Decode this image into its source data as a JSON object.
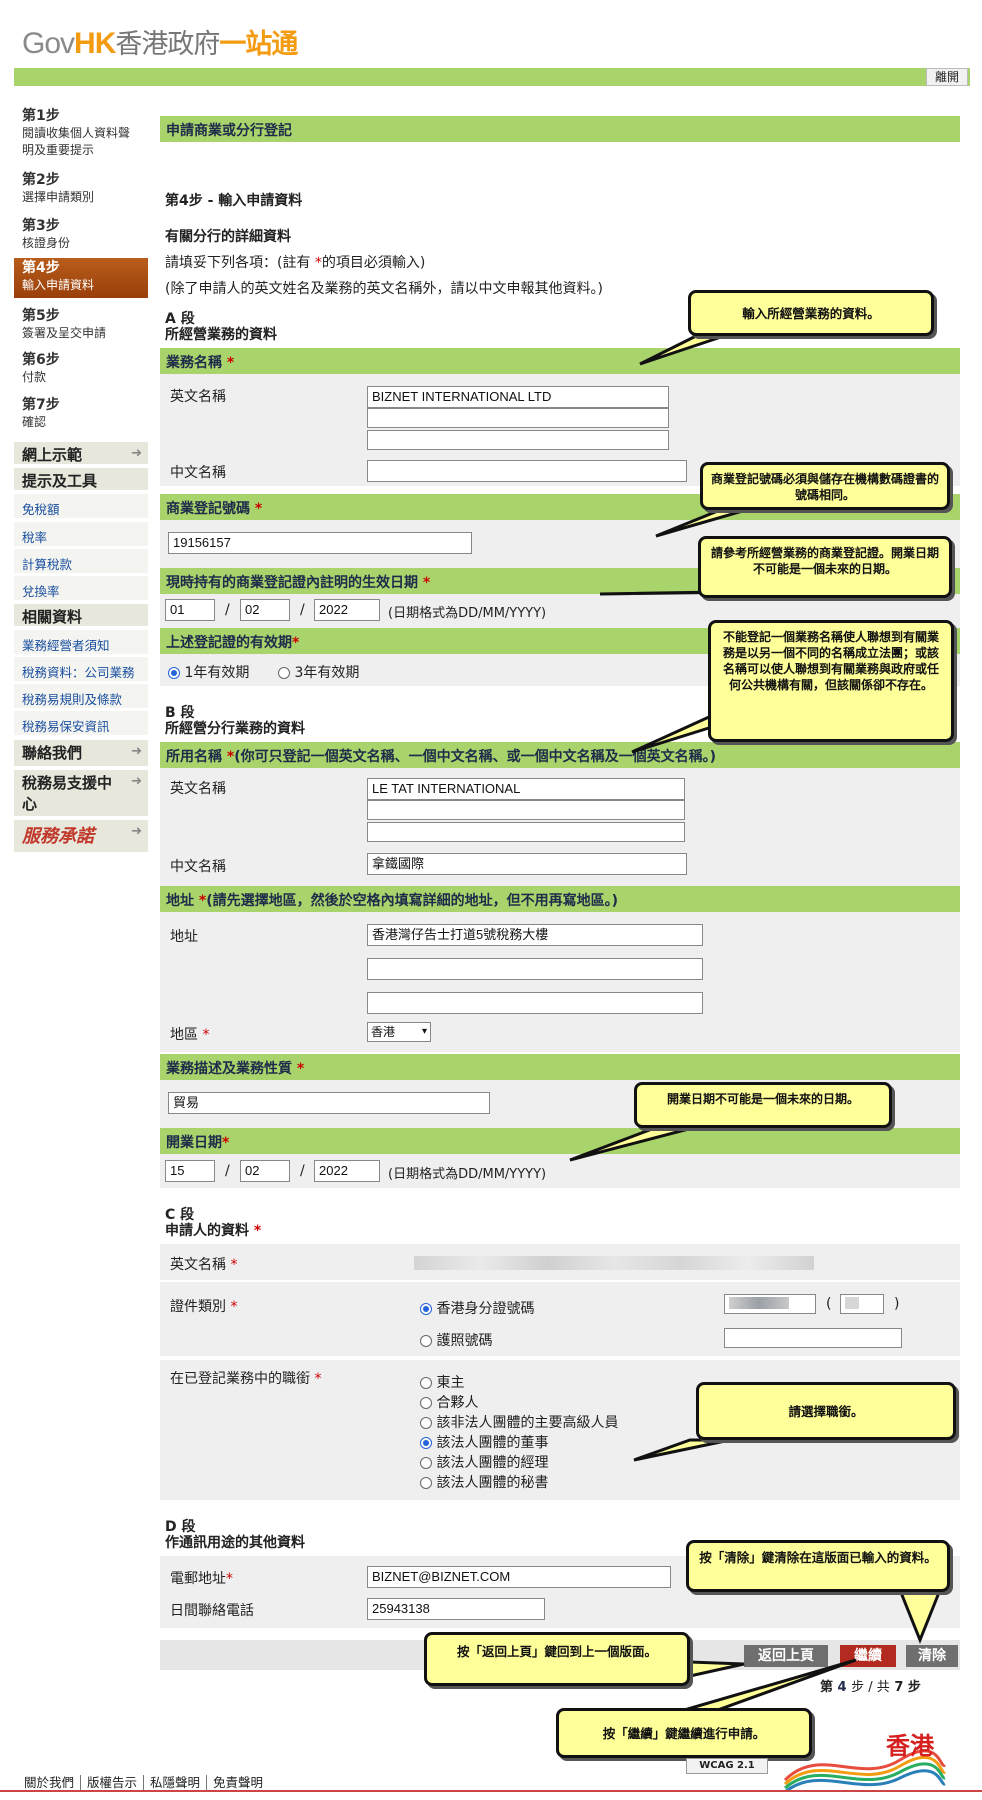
{
  "header": {
    "logo_gov": "Gov",
    "logo_hk": "HK",
    "logo_hkgov": "香港政府",
    "logo_onestop": "一站通",
    "logout_label": "離開"
  },
  "steps": [
    {
      "num": "第1步",
      "desc": "閱讀收集個人資料聲明及重要提示"
    },
    {
      "num": "第2步",
      "desc": "選擇申請類別"
    },
    {
      "num": "第3步",
      "desc": "核證身份"
    },
    {
      "num": "第4步",
      "desc": "輸入申請資料"
    },
    {
      "num": "第5步",
      "desc": "簽署及呈交申請"
    },
    {
      "num": "第6步",
      "desc": "付款"
    },
    {
      "num": "第7步",
      "desc": "確認"
    }
  ],
  "nav": {
    "demo": "網上示範",
    "tips": "提示及工具",
    "tips_links": [
      "免稅額",
      "稅率",
      "計算稅款",
      "兌換率"
    ],
    "related": "相關資料",
    "related_links": [
      "業務經營者須知",
      "稅務資料：公司業務",
      "稅務易規則及條款",
      "稅務易保安資訊"
    ],
    "contact": "聯絡我們",
    "support": "稅務易支援中心",
    "pledge": "服務承諾"
  },
  "page": {
    "title": "申請商業或分行登記",
    "step_title": "第4步  -  輸入申請資料",
    "subtitle": "有關分行的詳細資料",
    "note1_pre": "請填妥下列各項：(註有 ",
    "note1_star": "*",
    "note1_post": "的項目必須輸入)",
    "note2": "(除了申請人的英文姓名及業務的英文名稱外，請以中文申報其他資料。)"
  },
  "sectionA": {
    "label": "A 段",
    "title": "所經營業務的資料",
    "biz_name_header": "業務名稱",
    "english_name_label": "英文名稱",
    "english_name_values": [
      "BIZNET INTERNATIONAL LTD",
      "",
      ""
    ],
    "chinese_name_label": "中文名稱",
    "chinese_name_value": "",
    "brn_header": "商業登記號碼",
    "brn_value": "19156157",
    "cert_date_header": "現時持有的商業登記證內註明的生效日期",
    "cert_date": {
      "dd": "01",
      "mm": "02",
      "yyyy": "2022"
    },
    "date_format": "(日期格式為DD/MM/YYYY)",
    "validity_header": "上述登記證的有效期",
    "validity_options": [
      "1年有效期",
      "3年有效期"
    ],
    "validity_selected": 0
  },
  "sectionB": {
    "label": "B 段",
    "title": "所經營分行業務的資料",
    "name_header": "所用名稱",
    "name_note": "(你可只登記一個英文名稱、一個中文名稱、或一個中文名稱及一個英文名稱。)",
    "english_name_label": "英文名稱",
    "english_name_values": [
      "LE TAT INTERNATIONAL",
      "",
      ""
    ],
    "chinese_name_label": "中文名稱",
    "chinese_name_value": "拿鐵國際",
    "address_header": "地址",
    "address_note": "(請先選擇地區，然後於空格內填寫詳細的地址，但不用再寫地區。)",
    "address_label": "地址",
    "address_values": [
      "香港灣仔告士打道5號稅務大樓",
      "",
      ""
    ],
    "district_label": "地區",
    "district_value": "香港",
    "desc_header": "業務描述及業務性質",
    "desc_value": "貿易",
    "start_date_header": "開業日期",
    "start_date": {
      "dd": "15",
      "mm": "02",
      "yyyy": "2022"
    },
    "date_format": "(日期格式為DD/MM/YYYY)"
  },
  "sectionC": {
    "label": "C 段",
    "title": "申請人的資料",
    "english_name_label": "英文名稱",
    "doc_type_label": "證件類別",
    "doc_options": [
      "香港身分證號碼",
      "護照號碼"
    ],
    "doc_selected": 0,
    "position_label": "在已登記業務中的職銜",
    "positions": [
      "東主",
      "合夥人",
      "該非法人團體的主要高級人員",
      "該法人團體的董事",
      "該法人團體的經理",
      "該法人團體的秘書"
    ],
    "position_selected": 3
  },
  "sectionD": {
    "label": "D 段",
    "title": "作通訊用途的其他資料",
    "email_label": "電郵地址",
    "email_value": "BIZNET@BIZNET.COM",
    "phone_label": "日間聯絡電話",
    "phone_value": "25943138"
  },
  "buttons": {
    "back": "返回上頁",
    "continue": "繼續",
    "clear": "清除"
  },
  "progress": {
    "pre": "第",
    "current": "4",
    "mid": "步 / 共",
    "total": "7",
    "post": "步"
  },
  "callouts": {
    "c1": "輸入所經營業務的資料。",
    "c2": "商業登記號碼必須與儲存在機構數碼證書的號碼相同。",
    "c3": "請參考所經營業務的商業登記證。開業日期不可能是一個未來的日期。",
    "c4": "不能登記一個業務名稱使人聯想到有關業務是以另一個不同的名稱成立法團；或該名稱可以使人聯想到有關業務與政府或任何公共機構有關，但該關係卻不存在。",
    "c5": "開業日期不可能是一個未來的日期。",
    "c6": "請選擇職銜。",
    "c7": "按「清除」鍵清除在這版面已輸入的資料。",
    "c8": "按「返回上頁」鍵回到上一個版面。",
    "c9": "按「繼續」鍵繼續進行申請。"
  },
  "footer": {
    "links": [
      "關於我們",
      "版權告示",
      "私隱聲明",
      "免責聲明"
    ],
    "wcag": "WCAG 2.1",
    "brand": "香港"
  },
  "colors": {
    "green_bar": "#a9d46b",
    "active_step": "#b85d1b",
    "callout": "#ffff99",
    "required": "#cc0000"
  }
}
